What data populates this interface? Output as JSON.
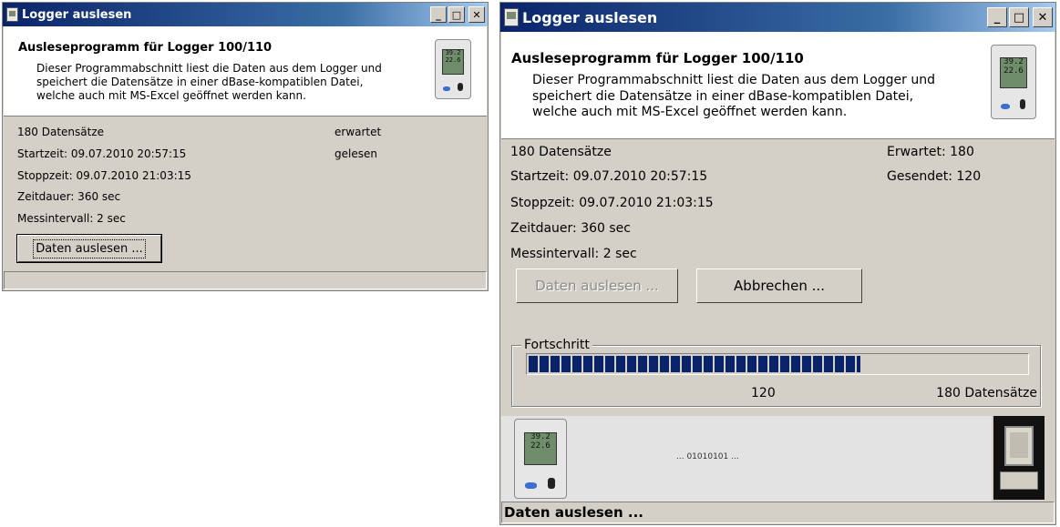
{
  "window_small": {
    "title": "Logger auslesen",
    "header_title": "Ausleseprogramm für Logger 100/110",
    "description": [
      "Dieser Programmabschnitt liest die Daten aus dem Logger und",
      "speichert die Datensätze in einer dBase-kompatiblen Datei,",
      "welche auch mit MS-Excel geöffnet werden kann."
    ],
    "records": "180 Datensätze",
    "start": "Startzeit: 09.07.2010 20:57:15",
    "stop": "Stoppzeit: 09.07.2010 21:03:15",
    "duration": "Zeitdauer: 360 sec",
    "interval": "Messintervall: 2 sec",
    "expected": "erwartet",
    "read": "gelesen",
    "read_button": "Daten auslesen ...",
    "device_display": "39.2\n22.6",
    "status": ""
  },
  "window_large": {
    "title": "Logger auslesen",
    "header_title": "Ausleseprogramm für Logger 100/110",
    "description": [
      "Dieser Programmabschnitt liest die Daten aus dem Logger und",
      "speichert die Datensätze in einer dBase-kompatiblen Datei,",
      "welche auch mit MS-Excel geöffnet werden kann."
    ],
    "records": "180 Datensätze",
    "start": "Startzeit: 09.07.2010 20:57:15",
    "stop": "Stoppzeit: 09.07.2010 21:03:15",
    "duration": "Zeitdauer: 360 sec",
    "interval": "Messintervall: 2 sec",
    "expected": "Erwartet: 180",
    "sent": "Gesendet: 120",
    "read_button": "Daten auslesen ...",
    "cancel_button": "Abbrechen ...",
    "progress_legend": "Fortschritt",
    "progress_fraction": 0.6667,
    "progress_current": "120",
    "progress_total": "180 Datensätze",
    "transfer_text": "... 01010101 ...",
    "device_display": "39.2\n22.6",
    "status": "Daten auslesen ..."
  },
  "title_buttons": {
    "minimize": "_",
    "maximize": "□",
    "close": "✕"
  },
  "colors": {
    "titlebar": "#0a246a",
    "progress": "#0a246a",
    "window_face": "#d4d0c8"
  }
}
